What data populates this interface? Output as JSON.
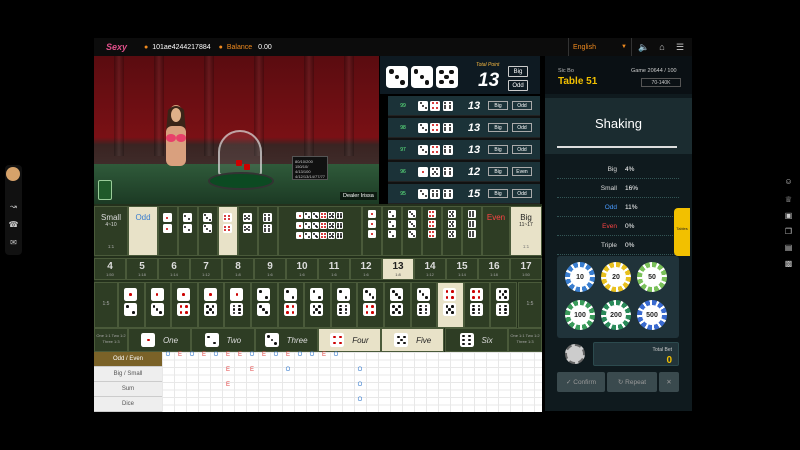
{
  "topbar": {
    "logo_text": "Sexy",
    "user_id": "101ae4244217884",
    "balance_label": "Balance",
    "balance_value": "0.00",
    "language": "English"
  },
  "video": {
    "dealer_name": "Dealer Irissa",
    "sign_text": "80/10/200 150/10/ 4/13/100 4/12/13/14/77/77"
  },
  "result": {
    "dice": [
      3,
      3,
      5
    ],
    "total_label": "Total Point",
    "total": "13",
    "tag1": "Big",
    "tag2": "Odd"
  },
  "history": [
    {
      "game": "99",
      "dice": [
        3,
        4,
        6
      ],
      "total": "13",
      "t1": "Big",
      "t2": "Odd"
    },
    {
      "game": "98",
      "dice": [
        3,
        4,
        6
      ],
      "total": "13",
      "t1": "Big",
      "t2": "Odd"
    },
    {
      "game": "97",
      "dice": [
        3,
        4,
        6
      ],
      "total": "13",
      "t1": "Big",
      "t2": "Odd"
    },
    {
      "game": "96",
      "dice": [
        1,
        5,
        6
      ],
      "total": "12",
      "t1": "Big",
      "t2": "Even"
    },
    {
      "game": "95",
      "dice": [
        3,
        6,
        6
      ],
      "total": "15",
      "t1": "Big",
      "t2": "Odd"
    }
  ],
  "panel": {
    "game_type": "Sic Bo",
    "table_name": "Table 51",
    "game_info": "Game 20644 / 100",
    "limit": "70-140K",
    "status": "Shaking",
    "stats": [
      {
        "label": "Big",
        "value": "4%",
        "color": "#dddddd"
      },
      {
        "label": "Small",
        "value": "16%",
        "color": "#dddddd"
      },
      {
        "label": "Odd",
        "value": "11%",
        "color": "#4a9cff"
      },
      {
        "label": "Even",
        "value": "0%",
        "color": "#ff4444"
      },
      {
        "label": "Triple",
        "value": "0%",
        "color": "#dddddd"
      }
    ],
    "chips": [
      "10",
      "20",
      "50",
      "100",
      "200",
      "500"
    ],
    "total_bet_label": "Total Bet",
    "total_bet": "0",
    "confirm_label": "Confirm",
    "repeat_label": "Repeat",
    "tables_label": "Tables"
  },
  "board": {
    "small_label": "Small",
    "small_range": "4~10",
    "odd_label": "Odd",
    "even_label": "Even",
    "big_label": "Big",
    "big_range": "11~17",
    "small_odds": "1:1",
    "big_odds": "1:1",
    "totals": [
      {
        "n": "4",
        "o": "1:50"
      },
      {
        "n": "5",
        "o": "1:18"
      },
      {
        "n": "6",
        "o": "1:14"
      },
      {
        "n": "7",
        "o": "1:12"
      },
      {
        "n": "8",
        "o": "1:8"
      },
      {
        "n": "9",
        "o": "1:6"
      },
      {
        "n": "10",
        "o": "1:6"
      },
      {
        "n": "11",
        "o": "1:6"
      },
      {
        "n": "12",
        "o": "1:6"
      },
      {
        "n": "13",
        "o": "1:8"
      },
      {
        "n": "14",
        "o": "1:12"
      },
      {
        "n": "15",
        "o": "1:14"
      },
      {
        "n": "16",
        "o": "1:18"
      },
      {
        "n": "17",
        "o": "1:50"
      }
    ],
    "combo_odds": "1:5",
    "singles": [
      "One",
      "Two",
      "Three",
      "Four",
      "Five",
      "Six"
    ],
    "single_odds_left": "One 1:1  Two 1:2  Three 1:3",
    "single_odds_right": "One 1:1  Two 1:2  Three 1:3"
  },
  "roadmap": {
    "labels": [
      "Odd / Even",
      "Big / Small",
      "Sum",
      "Dice"
    ],
    "oddeven": [
      "O",
      "E",
      "O",
      "E",
      "O",
      "E",
      "E",
      "O",
      "E",
      "O",
      "E",
      "O",
      "O",
      "E",
      "O"
    ],
    "bigsmall_E": [
      "E",
      "E"
    ],
    "bigsmall_O": [
      "O",
      "O"
    ]
  }
}
